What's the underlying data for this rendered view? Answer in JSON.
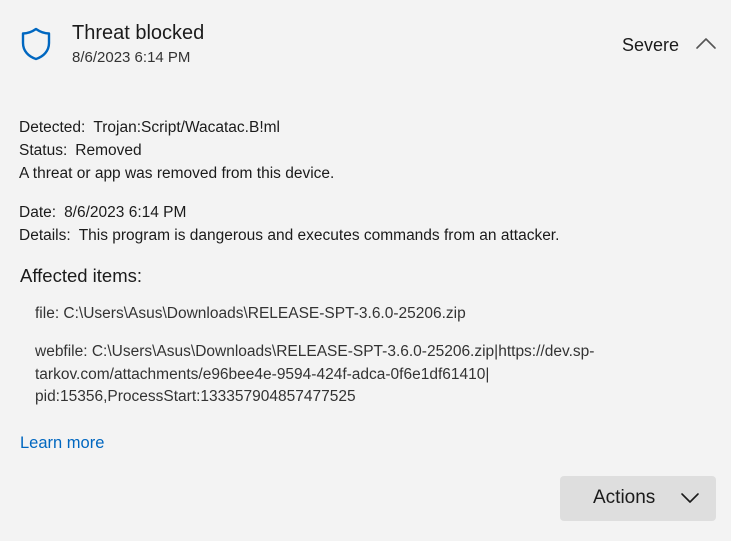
{
  "header": {
    "icon": "shield-icon",
    "title": "Threat blocked",
    "timestamp": "8/6/2023 6:14 PM",
    "severity": "Severe",
    "collapse_icon": "chevron-up-icon"
  },
  "details": {
    "detected_label": "Detected:",
    "detected_value": "Trojan:Script/Wacatac.B!ml",
    "status_label": "Status:",
    "status_value": "Removed",
    "status_message": "A threat or app was removed from this device.",
    "date_label": "Date:",
    "date_value": "8/6/2023 6:14 PM",
    "details_label": "Details:",
    "details_value": "This program is dangerous and executes commands from an attacker."
  },
  "affected": {
    "title": "Affected items:",
    "items": [
      {
        "lines": [
          "file: C:\\Users\\Asus\\Downloads\\RELEASE-SPT-3.6.0-25206.zip"
        ]
      },
      {
        "lines": [
          "webfile: C:\\Users\\Asus\\Downloads\\RELEASE-SPT-3.6.0-25206.zip|https://dev.sp-",
          "tarkov.com/attachments/e96bee4e-9594-424f-adca-0f6e1df61410|",
          "pid:15356,ProcessStart:133357904857477525"
        ]
      }
    ]
  },
  "links": {
    "learn_more": "Learn more"
  },
  "actions": {
    "label": "Actions",
    "icon": "chevron-down-icon"
  },
  "colors": {
    "background": "#f3f3f3",
    "accent": "#0067c0",
    "button_bg": "#dedede"
  }
}
